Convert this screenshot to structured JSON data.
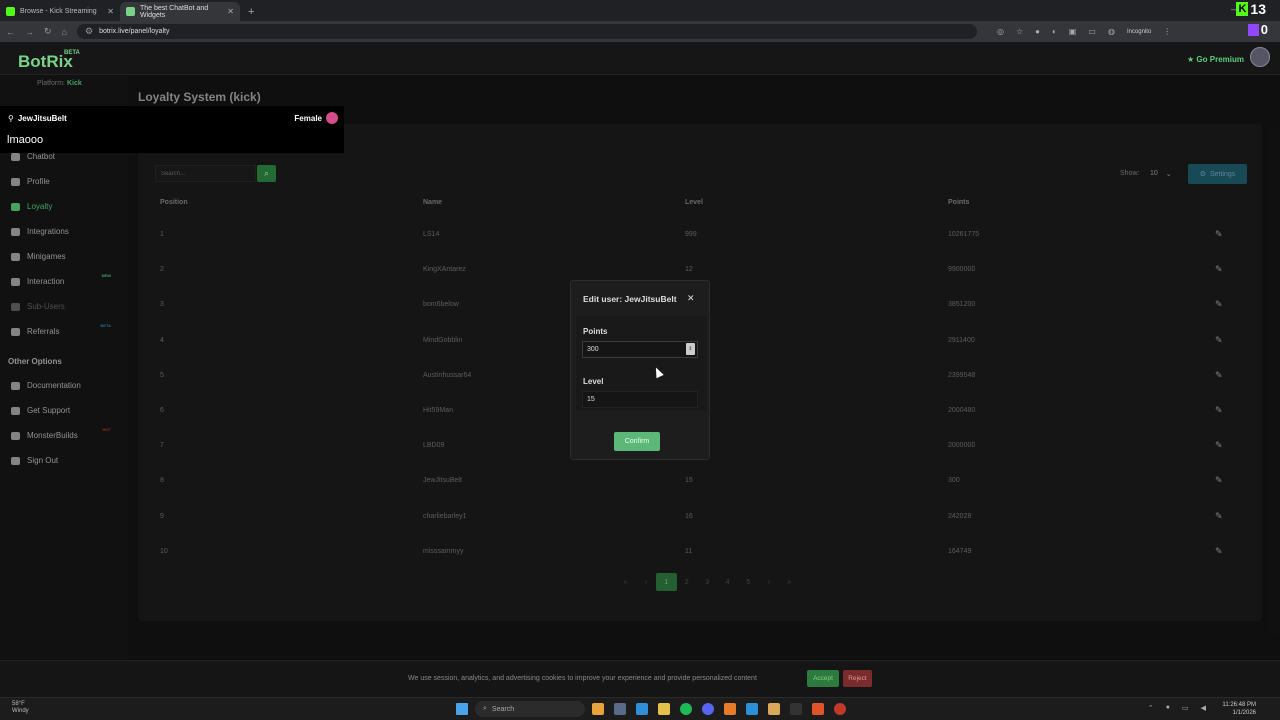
{
  "browser": {
    "tabs": [
      {
        "title": "Browse - Kick Streaming",
        "favicon_color": "#53fc18",
        "active": false
      },
      {
        "title": "The best ChatBot and Widgets",
        "favicon_color": "#7bd38a",
        "active": true
      }
    ],
    "url": "botrix.live/panel/loyalty",
    "incognito_label": "Incognito",
    "overlay_kick_count": "13",
    "overlay_twitch_count": "0"
  },
  "app": {
    "logo": "BotRix",
    "beta": "BETA",
    "platform_label": "Platform:",
    "platform_value": "Kick",
    "go_premium": "Go Premium"
  },
  "sidebar": {
    "items": [
      {
        "label": "Chatbot",
        "icon": "chat-icon",
        "state": "normal"
      },
      {
        "label": "Profile",
        "icon": "profile-icon",
        "state": "normal"
      },
      {
        "label": "Loyalty",
        "icon": "gem-icon",
        "state": "active"
      },
      {
        "label": "Integrations",
        "icon": "integrations-icon",
        "state": "normal"
      },
      {
        "label": "Minigames",
        "icon": "gamepad-icon",
        "state": "normal"
      },
      {
        "label": "Interaction",
        "icon": "music-icon",
        "state": "normal",
        "badge": "NEW",
        "badge_color": "#5cd07a"
      },
      {
        "label": "Sub-Users",
        "icon": "users-icon",
        "state": "muted"
      },
      {
        "label": "Referrals",
        "icon": "referrals-icon",
        "state": "normal",
        "badge": "BETA",
        "badge_color": "#3a8ab8"
      }
    ],
    "other_title": "Other Options",
    "other_items": [
      {
        "label": "Documentation",
        "icon": "book-icon",
        "state": "normal"
      },
      {
        "label": "Get Support",
        "icon": "question-icon",
        "state": "normal"
      },
      {
        "label": "MonsterBuilds",
        "icon": "laptop-icon",
        "state": "normal",
        "badge": "HOT",
        "badge_color": "#c0392b"
      },
      {
        "label": "Sign Out",
        "icon": "sign-out-icon",
        "state": "normal"
      }
    ]
  },
  "main": {
    "title": "Loyalty System (kick)",
    "search_placeholder": "Search...",
    "show_label": "Show:",
    "show_value": "10",
    "settings_label": "Settings",
    "columns": [
      "Position",
      "Name",
      "Level",
      "Points"
    ],
    "rows": [
      {
        "position": "1",
        "name": "LS14",
        "level": "999",
        "points": "10261775"
      },
      {
        "position": "2",
        "name": "KingXAntarez",
        "level": "12",
        "points": "9900000"
      },
      {
        "position": "3",
        "name": "bom6below",
        "level": "",
        "points": "3851200"
      },
      {
        "position": "4",
        "name": "MindGobblin",
        "level": "",
        "points": "2911400"
      },
      {
        "position": "5",
        "name": "Austinhussar64",
        "level": "",
        "points": "2399548"
      },
      {
        "position": "6",
        "name": "Hit59Man",
        "level": "",
        "points": "2000480"
      },
      {
        "position": "7",
        "name": "LBD09",
        "level": "",
        "points": "2000000"
      },
      {
        "position": "8",
        "name": "JewJitsuBelt",
        "level": "15",
        "points": "300"
      },
      {
        "position": "9",
        "name": "charliebarley1",
        "level": "16",
        "points": "242028"
      },
      {
        "position": "10",
        "name": "misssammyy",
        "level": "11",
        "points": "164749"
      }
    ],
    "pagination": [
      "«",
      "‹",
      "1",
      "2",
      "3",
      "4",
      "5",
      "›",
      "»"
    ],
    "current_page": "1"
  },
  "modal": {
    "title": "Edit user: JewJitsuBelt",
    "points_label": "Points",
    "points_value": "300",
    "level_label": "Level",
    "level_value": "15",
    "confirm_label": "Confirm"
  },
  "chat_overlay": {
    "username": "JewJitsuBelt",
    "gender": "Female",
    "message": "lmaooo"
  },
  "cookie_bar": {
    "text": "We use session, analytics, and advertising cookies to improve your experience and provide personalized content",
    "accept": "Accept",
    "reject": "Reject"
  },
  "taskbar": {
    "temp": "58°F",
    "condition": "Windy",
    "search": "Search",
    "time": "11:26:48 PM",
    "date": "1/1/2026"
  }
}
